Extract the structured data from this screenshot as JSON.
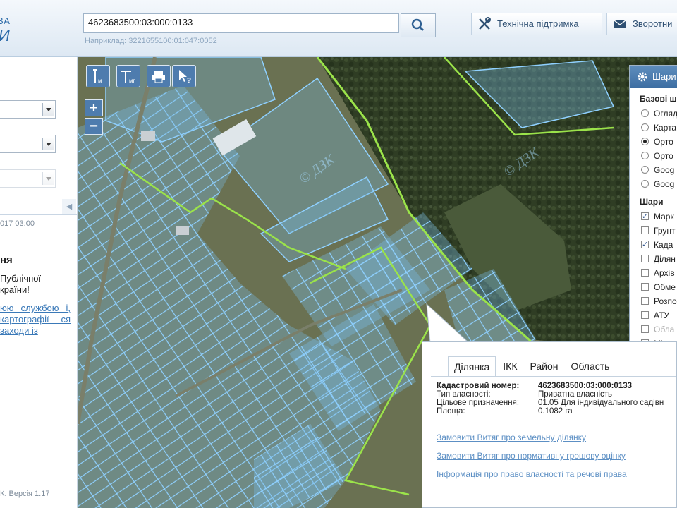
{
  "header": {
    "logo_top": "ВА",
    "logo_bottom": "И",
    "search_value": "4623683500:03:000:0133",
    "search_hint": "Наприклад: 3221655100:01:047:0052",
    "support_label": "Технічна підтримка",
    "feedback_label": "Зворотни"
  },
  "left_panel": {
    "date": "017 03:00",
    "news_title": "ня",
    "news_text": "Публічної країни!",
    "news_link": "юю службою і, картографії ся заходи із",
    "version": "К. Версія 1.17"
  },
  "map": {
    "tools": [
      "Iм",
      "Tмг",
      "print",
      "pointer-help"
    ],
    "zoom_in": "+",
    "zoom_out": "−",
    "watermark": "© ДЗК"
  },
  "layers_panel": {
    "title": "Шари",
    "base_title": "Базові ш",
    "base_layers": [
      {
        "label": "Огляд",
        "selected": false
      },
      {
        "label": "Карта",
        "selected": false
      },
      {
        "label": "Орто",
        "selected": true
      },
      {
        "label": "Орто",
        "selected": false
      },
      {
        "label": "Goog",
        "selected": false
      },
      {
        "label": "Goog",
        "selected": false
      }
    ],
    "layers_title": "Шари",
    "layers": [
      {
        "label": "Марк",
        "checked": true,
        "disabled": false
      },
      {
        "label": "Грунт",
        "checked": false,
        "disabled": false
      },
      {
        "label": "Када",
        "checked": true,
        "disabled": false
      },
      {
        "label": "Ділян",
        "checked": false,
        "disabled": false
      },
      {
        "label": "Архів",
        "checked": false,
        "disabled": false
      },
      {
        "label": "Обме",
        "checked": false,
        "disabled": false
      },
      {
        "label": "Розпо",
        "checked": false,
        "disabled": false
      },
      {
        "label": "АТУ",
        "checked": false,
        "disabled": false
      },
      {
        "label": "Обла",
        "checked": false,
        "disabled": true
      },
      {
        "label": "Місце",
        "checked": false,
        "disabled": false
      }
    ]
  },
  "popup": {
    "tabs": [
      "Ділянка",
      "ІКК",
      "Район",
      "Область"
    ],
    "active_tab": "Ділянка",
    "info": [
      {
        "key": "Кадастровий номер:",
        "value": "4623683500:03:000:0133",
        "bold": true
      },
      {
        "key": "Тип власності:",
        "value": "Приватна власність",
        "bold": false
      },
      {
        "key": "Цільове призначення:",
        "value": "01.05 Для індивідуального садівн",
        "bold": false
      },
      {
        "key": "Площа:",
        "value": "0.1082 га",
        "bold": false
      }
    ],
    "links": [
      "Замовити Витяг про земельну ділянку",
      "Замовити Витяг про нормативну грошову оцінку",
      "Інформація про право власності та речові права"
    ]
  },
  "colors": {
    "accent": "#3d6ea2",
    "parcel_stroke": "#8fd0ff",
    "boundary": "#9be34a",
    "link": "#5c8fc4"
  }
}
